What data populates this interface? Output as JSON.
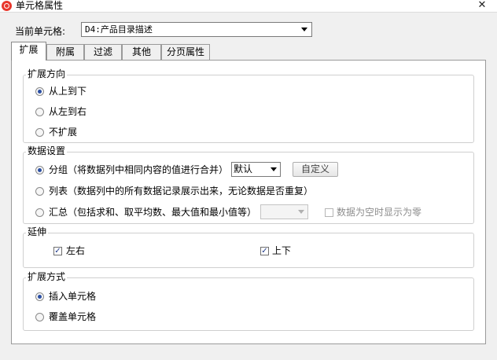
{
  "window": {
    "title": "单元格属性",
    "close_glyph": "✕"
  },
  "current_cell": {
    "label": "当前单元格:",
    "value": "D4:产品目录描述"
  },
  "tabs": [
    {
      "label": "扩展",
      "active": true
    },
    {
      "label": "附属"
    },
    {
      "label": "过滤"
    },
    {
      "label": "其他"
    },
    {
      "label": "分页属性"
    }
  ],
  "expand_direction": {
    "title": "扩展方向",
    "options": [
      {
        "label": "从上到下",
        "selected": true
      },
      {
        "label": "从左到右",
        "selected": false
      },
      {
        "label": "不扩展",
        "selected": false
      }
    ]
  },
  "data_settings": {
    "title": "数据设置",
    "group_option": {
      "label": "分组（将数据列中相同内容的值进行合并）",
      "selected": true,
      "select_value": "默认",
      "button_label": "自定义"
    },
    "list_option": {
      "label": "列表（数据列中的所有数据记录展示出来，无论数据是否重复）",
      "selected": false
    },
    "summary_option": {
      "label": "汇总（包括求和、取平均数、最大值和最小值等）",
      "selected": false,
      "select_value": "",
      "empty_check_label": "数据为空时显示为零",
      "empty_check_checked": false
    }
  },
  "extend": {
    "title": "延伸",
    "left_right": {
      "label": "左右",
      "checked": true
    },
    "up_down": {
      "label": "上下",
      "checked": true
    }
  },
  "expand_mode": {
    "title": "扩展方式",
    "options": [
      {
        "label": "插入单元格",
        "selected": true
      },
      {
        "label": "覆盖单元格",
        "selected": false
      }
    ]
  }
}
